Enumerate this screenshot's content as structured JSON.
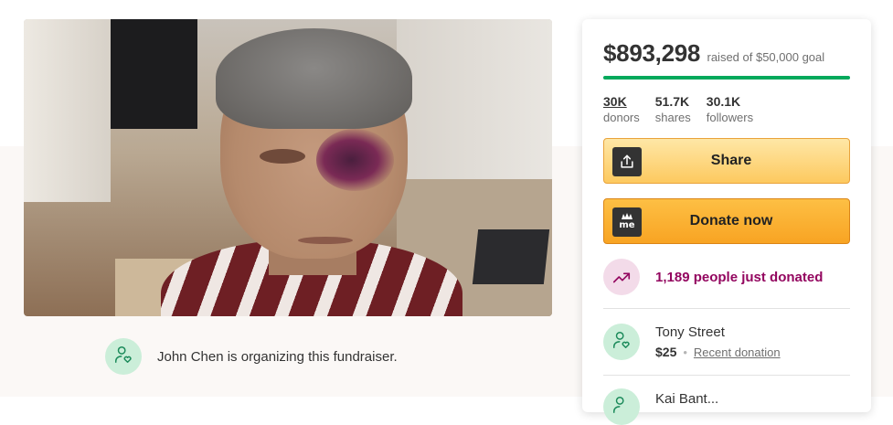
{
  "organizer": {
    "text": "John Chen is organizing this fundraiser.",
    "icon": "user-heart-icon"
  },
  "progress": {
    "raised": "$893,298",
    "goal_text": "raised of $50,000 goal",
    "fill_fraction": 1.0,
    "color": "#02a95c"
  },
  "stats": [
    {
      "value": "30K",
      "label": "donors"
    },
    {
      "value": "51.7K",
      "label": "shares"
    },
    {
      "value": "30.1K",
      "label": "followers"
    }
  ],
  "buttons": {
    "share_label": "Share",
    "share_icon": "share-upload-icon",
    "donate_label": "Donate now",
    "donate_icon": "gofundme-logo-icon",
    "donate_icon_text": "me"
  },
  "activity": {
    "just_donated": "1,189 people just donated",
    "icon": "trending-up-icon",
    "accent_color": "#93065f"
  },
  "donations": [
    {
      "name": "Tony Street",
      "amount": "$25",
      "link_text": "Recent donation"
    },
    {
      "name": "Kai Bant..."
    }
  ],
  "colors": {
    "share_button": "#fdc95f",
    "donate_button": "#f8a423",
    "avatar_bg": "#cbeed9"
  }
}
